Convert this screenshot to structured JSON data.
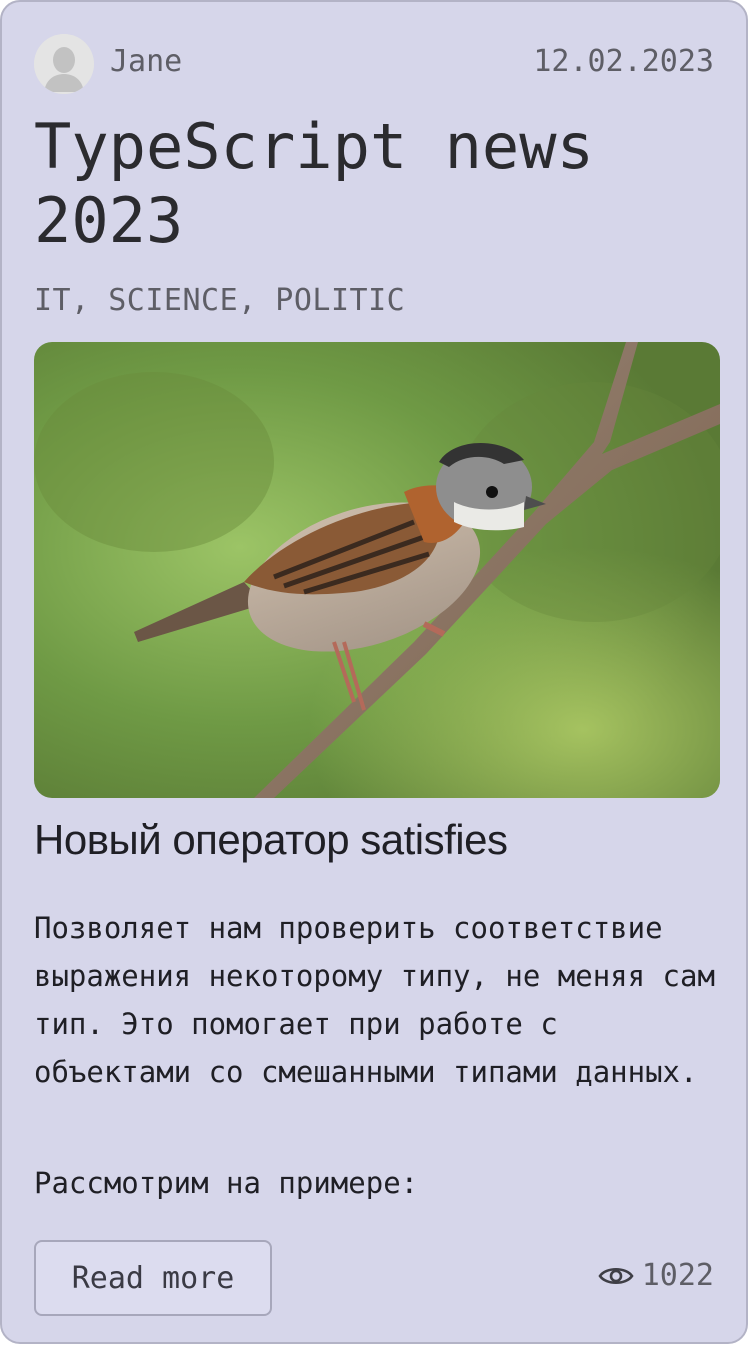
{
  "post": {
    "author": "Jane",
    "date": "12.02.2023",
    "title": "TypeScript news 2023",
    "tags": "IT, SCIENCE, POLITIC",
    "image": {
      "icon": "bird-photo",
      "alt": ""
    },
    "subtitle": "Новый оператор satisfies",
    "body_p1": "Позволяет нам проверить соответствие выражения некоторому типу, не меняя сам тип. Это помогает при работе с объектами со смешанными типами данных.",
    "body_p2": "Рассмотрим на примере:",
    "read_more_label": "Read more",
    "views": "1022"
  },
  "colors": {
    "card_bg": "#d6d6ea",
    "card_border": "#b3b3c6",
    "text_primary": "#1f1f25",
    "text_muted": "#5e5e66"
  }
}
